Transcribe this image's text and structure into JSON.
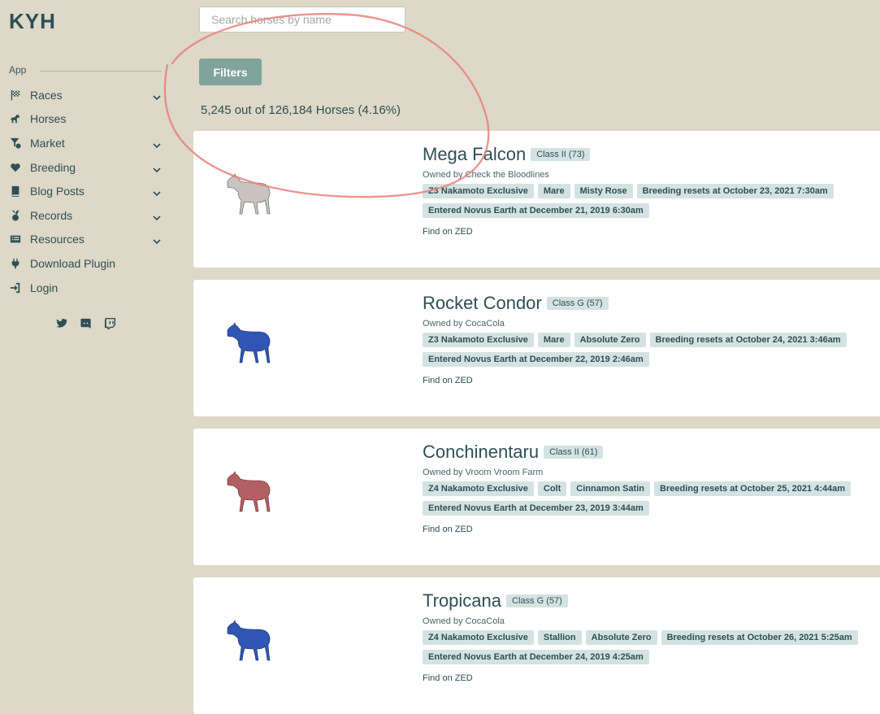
{
  "logo": "KYH",
  "sidebar": {
    "section_label": "App",
    "items": [
      {
        "label": "Races",
        "icon": "checkered-flag-icon",
        "expandable": true
      },
      {
        "label": "Horses",
        "icon": "horse-icon",
        "expandable": false
      },
      {
        "label": "Market",
        "icon": "filter-dollar-icon",
        "expandable": true
      },
      {
        "label": "Breeding",
        "icon": "heart-icon",
        "expandable": true
      },
      {
        "label": "Blog Posts",
        "icon": "book-icon",
        "expandable": true
      },
      {
        "label": "Records",
        "icon": "medal-icon",
        "expandable": true
      },
      {
        "label": "Resources",
        "icon": "list-icon",
        "expandable": true
      },
      {
        "label": "Download Plugin",
        "icon": "plug-icon",
        "expandable": false
      },
      {
        "label": "Login",
        "icon": "login-icon",
        "expandable": false
      }
    ],
    "social": [
      "twitter-icon",
      "discord-icon",
      "twitch-icon"
    ]
  },
  "search": {
    "placeholder": "Search horses by name",
    "value": ""
  },
  "filters_label": "Filters",
  "result_count": "5,245 out of 126,184 Horses (4.16%)",
  "horses": [
    {
      "name": "Mega Falcon",
      "class": "Class II (73)",
      "owner": "Owned by Check the Bloodlines",
      "color": "#c9c4c0",
      "tags": [
        "Z3 Nakamoto Exclusive",
        "Mare",
        "Misty Rose",
        "Breeding resets at October 23, 2021 7:30am",
        "Entered Novus Earth at December 21, 2019 6:30am"
      ],
      "link": "Find on ZED"
    },
    {
      "name": "Rocket Condor",
      "class": "Class G (57)",
      "owner": "Owned by CocaCola",
      "color": "#2f55b5",
      "tags": [
        "Z3 Nakamoto Exclusive",
        "Mare",
        "Absolute Zero",
        "Breeding resets at October 24, 2021 3:46am",
        "Entered Novus Earth at December 22, 2019 2:46am"
      ],
      "link": "Find on ZED"
    },
    {
      "name": "Conchinentaru",
      "class": "Class II (61)",
      "owner": "Owned by Vroom Vroom Farm",
      "color": "#b25e63",
      "tags": [
        "Z4 Nakamoto Exclusive",
        "Colt",
        "Cinnamon Satin",
        "Breeding resets at October 25, 2021 4:44am",
        "Entered Novus Earth at December 23, 2019 3:44am"
      ],
      "link": "Find on ZED"
    },
    {
      "name": "Tropicana",
      "class": "Class G (57)",
      "owner": "Owned by CocaCola",
      "color": "#2f55b5",
      "tags": [
        "Z4 Nakamoto Exclusive",
        "Stallion",
        "Absolute Zero",
        "Breeding resets at October 26, 2021 5:25am",
        "Entered Novus Earth at December 24, 2019 4:25am"
      ],
      "link": "Find on ZED"
    }
  ]
}
